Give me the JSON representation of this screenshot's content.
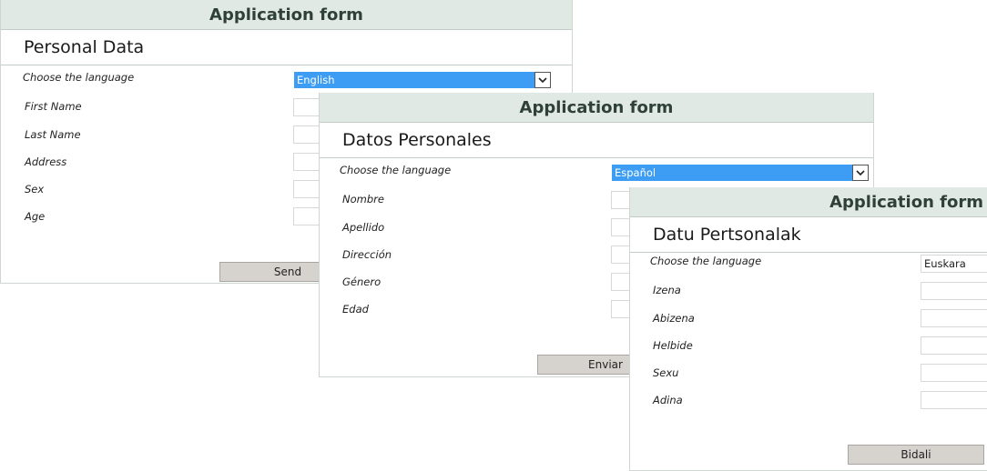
{
  "forms": [
    {
      "header": "Application form",
      "section_title": "Personal Data",
      "language_label": "Choose the language",
      "language_value": "English",
      "fields": [
        "First Name",
        "Last Name",
        "Address",
        "Sex",
        "Age"
      ],
      "submit_label": "Send"
    },
    {
      "header": "Application form",
      "section_title": "Datos Personales",
      "language_label": "Choose the language",
      "language_value": "Español",
      "fields": [
        "Nombre",
        "Apellido",
        "Dirección",
        "Género",
        "Edad"
      ],
      "submit_label": "Enviar"
    },
    {
      "header": "Application form",
      "section_title": "Datu Pertsonalak",
      "language_label": "Choose the language",
      "language_value": "Euskara",
      "fields": [
        "Izena",
        "Abizena",
        "Helbide",
        "Sexu",
        "Adina"
      ],
      "submit_label": "Bidali"
    }
  ],
  "colors": {
    "header_bg": "#e1e9e4",
    "select_highlight": "#3d9df4",
    "button_bg": "#d6d3ce"
  },
  "icons": {
    "dropdown": "chevron-down-icon"
  }
}
